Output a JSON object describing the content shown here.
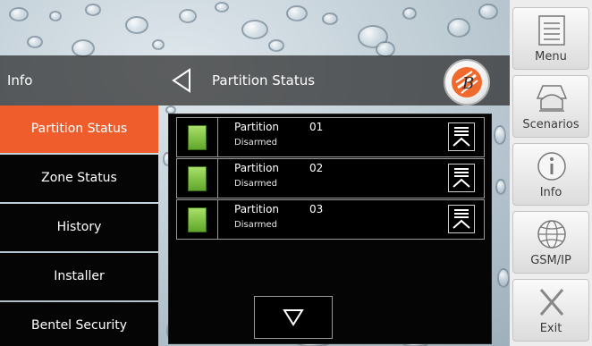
{
  "header": {
    "section_title": "Info",
    "page_title": "Partition Status"
  },
  "left_menu": {
    "items": [
      {
        "label": "Partition Status",
        "active": true
      },
      {
        "label": "Zone Status",
        "active": false
      },
      {
        "label": "History",
        "active": false
      },
      {
        "label": "Installer",
        "active": false
      },
      {
        "label": "Bentel Security",
        "active": false
      }
    ]
  },
  "partitions": [
    {
      "label": "Partition",
      "number": "01",
      "status": "Disarmed",
      "led_color": "#7bc143"
    },
    {
      "label": "Partition",
      "number": "02",
      "status": "Disarmed",
      "led_color": "#7bc143"
    },
    {
      "label": "Partition",
      "number": "03",
      "status": "Disarmed",
      "led_color": "#7bc143"
    }
  ],
  "right_menu": {
    "items": [
      {
        "label": "Menu",
        "icon": "menu-icon"
      },
      {
        "label": "Scenarios",
        "icon": "scenarios-icon"
      },
      {
        "label": "Info",
        "icon": "info-icon"
      },
      {
        "label": "GSM/IP",
        "icon": "globe-icon"
      },
      {
        "label": "Exit",
        "icon": "exit-icon"
      }
    ]
  },
  "colors": {
    "active_tab": "#ee5d2b",
    "panel_bg": "#050505",
    "led_ok": "#7bc143"
  }
}
